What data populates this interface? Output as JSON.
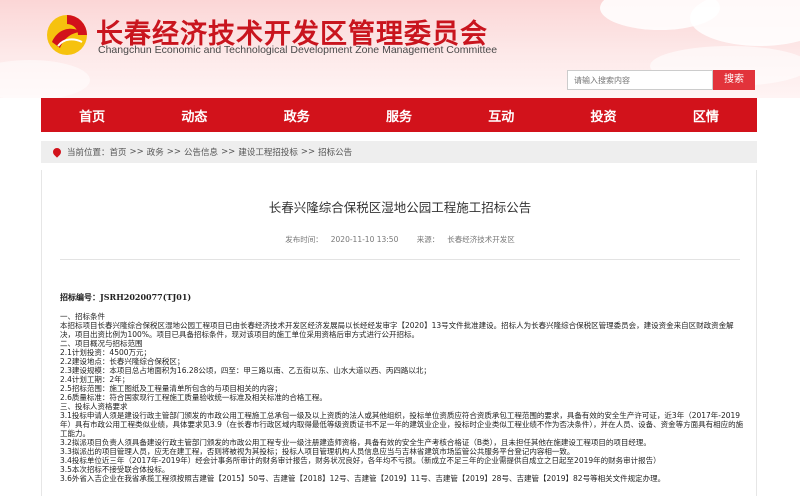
{
  "header": {
    "title": "长春经济技术开发区管理委员会",
    "subtitle": "Changchun Economic and Technological Development Zone Management Committee",
    "search_placeholder": "请输入搜索内容",
    "search_button": "搜索",
    "colors": {
      "brand_red": "#d2121b",
      "title_red": "#c9151e"
    }
  },
  "nav": {
    "items": [
      "首页",
      "动态",
      "政务",
      "服务",
      "互动",
      "投资",
      "区情"
    ]
  },
  "breadcrumb": {
    "prefix": "当前位置：",
    "items": [
      "首页",
      "政务",
      "公告信息",
      "建设工程招投标",
      "招标公告"
    ],
    "separator": ">>"
  },
  "article": {
    "title": "长春兴隆综合保税区湿地公园工程施工招标公告",
    "date_label": "发布时间：",
    "date": "2020-11-10 13:50",
    "source_label": "来源：",
    "source": "长春经济技术开发区",
    "bid_number": "招标编号：JSRH2020077(TJ01)",
    "lines": [
      "一、招标条件",
      "本招标项目长春兴隆综合保税区湿地公园工程项目已由长春经济技术开发区经济发展局以长经经发审字【2020】13号文件批准建设。招标人为长春兴隆综合保税区管理委员会，建设资金来自区财政资金解决，项目出资比例为100%。项目已具备招标条件，现对该项目的施工单位采用资格后审方式进行公开招标。",
      "二、项目概况与招标范围",
      "2.1计划投资：4500万元；",
      "2.2建设地点：长春兴隆综合保税区；",
      "2.3建设规模：本项目总占地面积为16.28公顷，四至：甲三路以南、乙五街以东、山水大道以西、丙四路以北；",
      "2.4计划工期：2年；",
      "2.5招标范围：施工图纸及工程量清单所包含的与项目相关的内容；",
      "2.6质量标准：符合国家现行工程施工质量验收统一标准及相关标准的合格工程。",
      "三、投标人资格要求",
      "3.1投标申请人须是建设行政主管部门颁发的市政公用工程施工总承包一级及以上资质的法人或其他组织，投标单位资质应符合资质承包工程范围的要求，具备有效的安全生产许可证，近3年（2017年-2019年）具有市政公用工程类似业绩，具体要求见3.9（在长春市行政区域内取得最低等级资质证书不足一年的建筑业企业，投标时企业类似工程业绩不作为否决条件），并在人员、设备、资金等方面具有相应的施工能力。",
      "3.2拟派项目负责人须具备建设行政主管部门颁发的市政公用工程专业一级注册建造师资格，具备有效的安全生产考核合格证（B类），且未担任其他在施建设工程项目的项目经理。",
      "3.3拟派出的项目管理人员，应无在建工程，否则将被视为其投标；投标人项目管理机构人员信息应当与吉林省建筑市场监管公共服务平台登记内容相一致。",
      "3.4投标单位近三年（2017年-2019年）经会计事务所审计的财务审计报告，财务状况良好，各年均不亏损。（新成立不足三年的企业需提供自成立之日起至2019年的财务审计报告）",
      "3.5本次招标不接受联合体投标。",
      "3.6外省入吉企业在我省承揽工程须按照吉建管【2015】50号、吉建管【2018】12号、吉建管【2019】11号、吉建管【2019】28号、吉建管【2019】82号等相关文件规定办理。"
    ]
  }
}
